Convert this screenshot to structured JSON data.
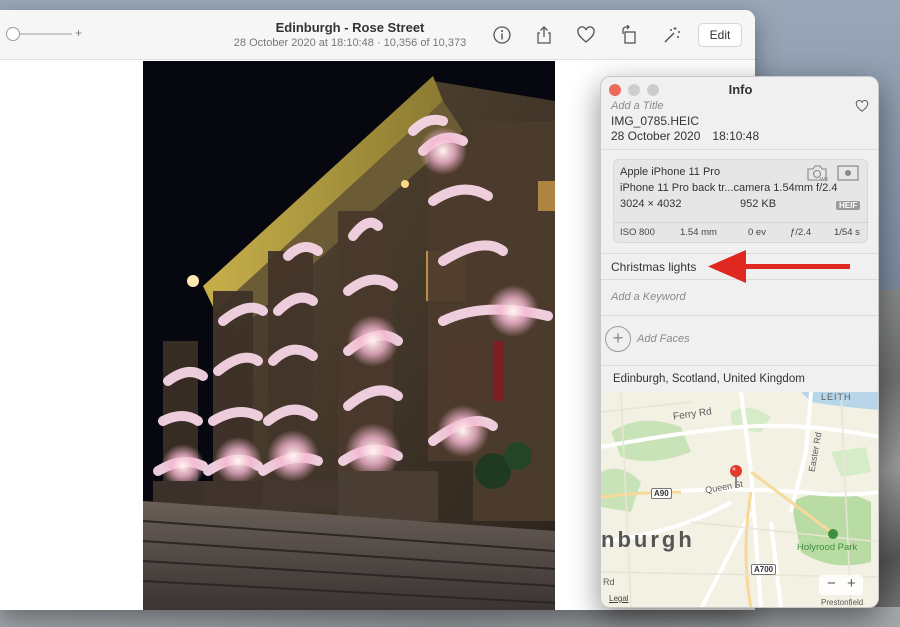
{
  "toolbar": {
    "zoom_plus": "+",
    "title": "Edinburgh - Rose Street",
    "subtitle": "28 October 2020 at 18:10:48  ·  10,356 of 10,373",
    "edit_label": "Edit",
    "icons": [
      "info-icon",
      "share-icon",
      "heart-icon",
      "rotate-icon",
      "auto-enhance-icon"
    ]
  },
  "info": {
    "title": "Info",
    "add_title_placeholder": "Add a Title",
    "filename": "IMG_0785.HEIC",
    "date": "28 October 2020",
    "time": "18:10:48",
    "camera": {
      "model": "Apple iPhone 11 Pro",
      "lens": "iPhone 11 Pro back tr...camera 1.54mm f/2.4",
      "resolution": "3024 × 4032",
      "size": "952 KB",
      "format_badge": "HEIF",
      "exif": {
        "iso": "ISO 800",
        "focal": "1.54 mm",
        "ev": "0 ev",
        "aperture": "ƒ/2.4",
        "shutter": "1/54 s"
      }
    },
    "caption": "Christmas lights",
    "keyword_placeholder": "Add a Keyword",
    "faces_label": "Add Faces",
    "location": "Edinburgh, Scotland, United Kingdom"
  },
  "map": {
    "labels": {
      "leith": "LEITH",
      "ferry_rd": "Ferry Rd",
      "queen_st": "Queen St",
      "easter_rd": "Easter Rd",
      "city": "nburgh",
      "holyrood": "Holyrood Park",
      "prestonfield": "Prestonfield",
      "rd": "Rd",
      "a90": "A90",
      "a700": "A700",
      "legal": "Legal",
      "zoom_out": "−",
      "zoom_in": "+"
    }
  },
  "colors": {
    "arrow": "#e02820",
    "pin": "#e23b2e",
    "close": "#ec6a5e",
    "inactive": "#cdcdcd"
  }
}
